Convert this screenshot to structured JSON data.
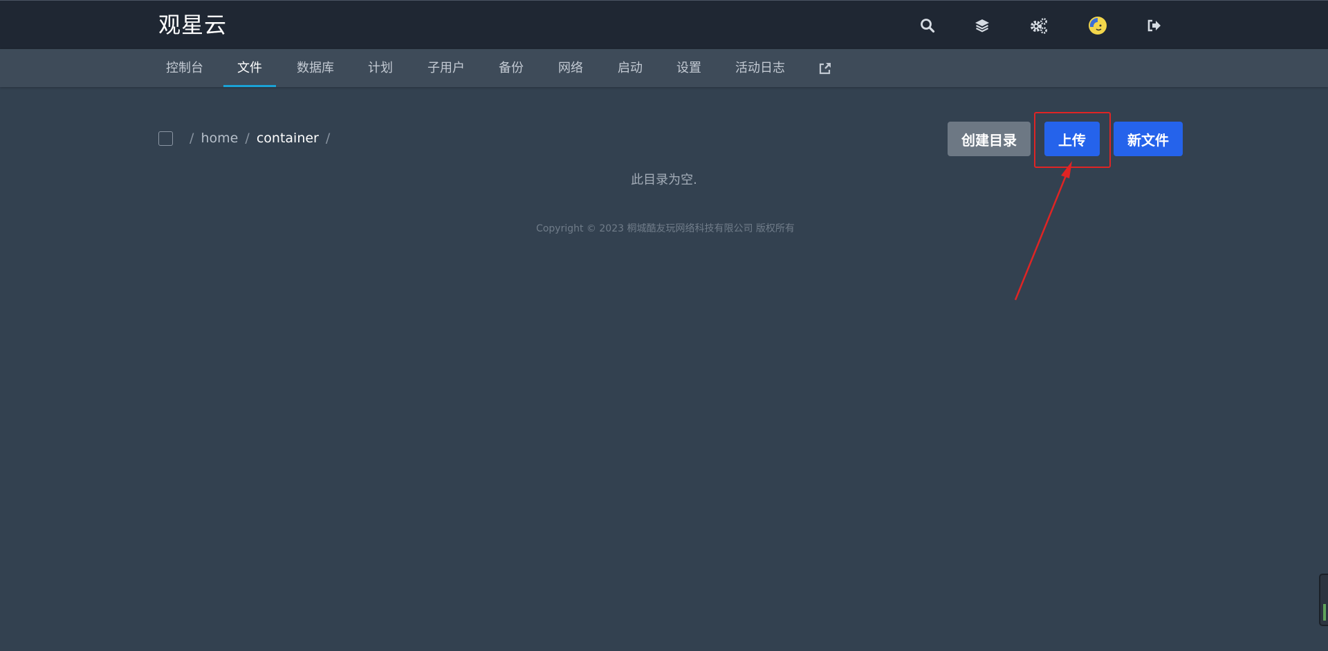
{
  "header": {
    "brand": "观星云",
    "icons": {
      "search": "search-icon",
      "layers": "layers-icon",
      "settings": "cogs-icon",
      "avatar": "avatar-icon",
      "logout": "sign-out-icon"
    }
  },
  "nav": {
    "items": [
      {
        "label": "控制台",
        "active": false
      },
      {
        "label": "文件",
        "active": true
      },
      {
        "label": "数据库",
        "active": false
      },
      {
        "label": "计划",
        "active": false
      },
      {
        "label": "子用户",
        "active": false
      },
      {
        "label": "备份",
        "active": false
      },
      {
        "label": "网络",
        "active": false
      },
      {
        "label": "启动",
        "active": false
      },
      {
        "label": "设置",
        "active": false
      },
      {
        "label": "活动日志",
        "active": false
      }
    ],
    "external_link_icon": "external-link-icon"
  },
  "breadcrumb": {
    "separator": "/",
    "parts": [
      "home",
      "container"
    ]
  },
  "actions": {
    "create_dir": "创建目录",
    "upload": "上传",
    "new_file": "新文件"
  },
  "content": {
    "empty_message": "此目录为空."
  },
  "footer": {
    "copyright": "Copyright © 2023 桐城酷友玩网络科技有限公司 版权所有"
  },
  "colors": {
    "background": "#334150",
    "topbar": "#1f2733",
    "navbar": "#3e4b59",
    "accent_blue": "#2563eb",
    "active_underline": "#1aa3d6",
    "annotation_red": "#e02424"
  }
}
